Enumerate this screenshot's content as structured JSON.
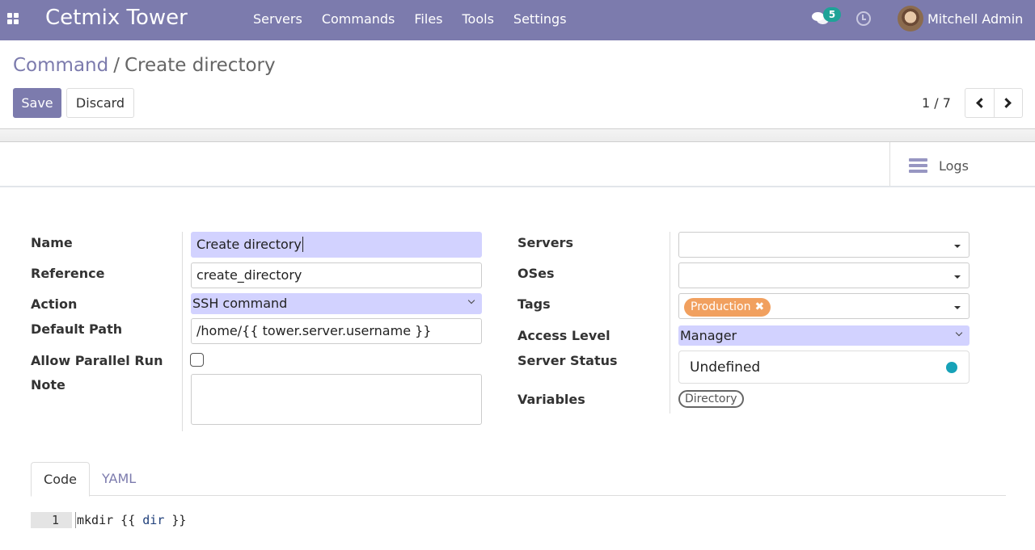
{
  "navbar": {
    "brand": "Cetmix Tower",
    "menu": [
      "Servers",
      "Commands",
      "Files",
      "Tools",
      "Settings"
    ],
    "messages_count": "5",
    "user_name": "Mitchell Admin",
    "icons": {
      "apps": "apps-grid-icon",
      "chat": "chat-icon",
      "activity": "clock-icon"
    }
  },
  "breadcrumb": {
    "parent": "Command",
    "separator": "/",
    "current": "Create directory"
  },
  "actions": {
    "save": "Save",
    "discard": "Discard"
  },
  "pager": {
    "value": "1 / 7"
  },
  "buttonbox": {
    "logs": "Logs"
  },
  "form": {
    "left": {
      "name_label": "Name",
      "name_value": "Create directory",
      "reference_label": "Reference",
      "reference_value": "create_directory",
      "action_label": "Action",
      "action_value": "SSH command",
      "default_path_label": "Default Path",
      "default_path_value": "/home/{{ tower.server.username }}",
      "parallel_label": "Allow Parallel Run",
      "parallel_checked": false,
      "note_label": "Note",
      "note_value": ""
    },
    "right": {
      "servers_label": "Servers",
      "servers_value": "",
      "oses_label": "OSes",
      "oses_value": "",
      "tags_label": "Tags",
      "tags": [
        "Production"
      ],
      "tag_color": "#f1a05f",
      "access_label": "Access Level",
      "access_value": "Manager",
      "server_status_label": "Server Status",
      "server_status_value": "Undefined",
      "server_status_color": "#17a2b8",
      "variables_label": "Variables",
      "variables": [
        "Directory"
      ]
    }
  },
  "tabs": [
    {
      "label": "Code",
      "active": true
    },
    {
      "label": "YAML",
      "active": false
    }
  ],
  "code": {
    "line_number": "1",
    "prefix": "mkdir {{ ",
    "variable": "dir",
    "suffix": " }}"
  },
  "colors": {
    "brand": "#7c7bad",
    "required_field": "#d2d2ff",
    "badge": "#1fa398"
  }
}
